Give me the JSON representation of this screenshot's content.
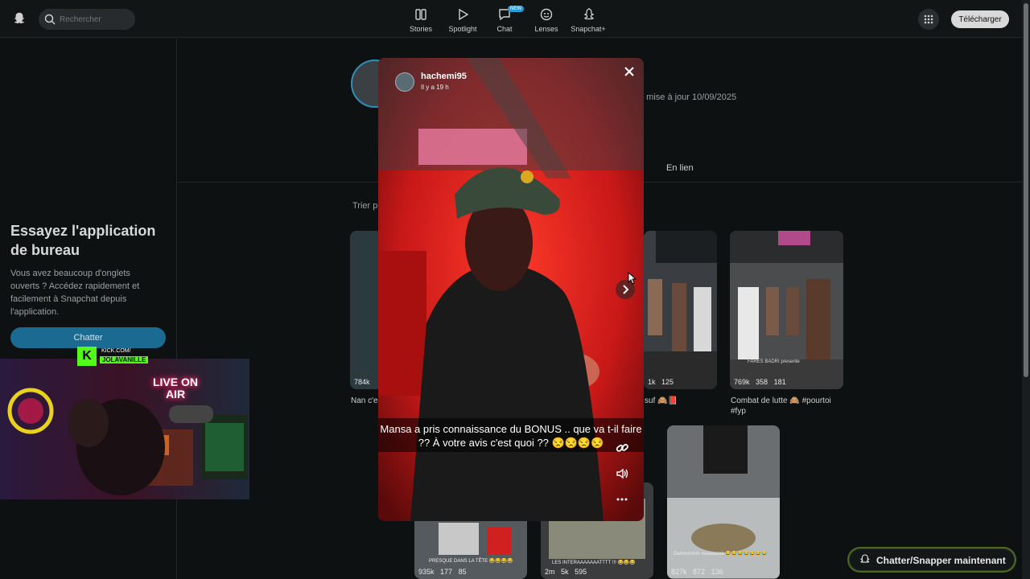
{
  "nav": {
    "search_placeholder": "Rechercher",
    "items": [
      {
        "label": "Stories",
        "icon": "stories-icon"
      },
      {
        "label": "Spotlight",
        "icon": "spotlight-play-icon"
      },
      {
        "label": "Chat",
        "icon": "chat-bubble-icon",
        "badge": "NEW"
      },
      {
        "label": "Lenses",
        "icon": "lenses-icon"
      },
      {
        "label": "Snapchat+",
        "icon": "snapchat-plus-icon"
      }
    ],
    "download_label": "Télécharger"
  },
  "profile": {
    "update_text": "e mise à jour 10/09/2025",
    "tab_label": "En lien",
    "sort_label": "Trier p"
  },
  "sidebar": {
    "promo_title": "Essayez l'application de bureau",
    "promo_text": "Vous avez beaucoup d'onglets ouverts ? Accédez rapidement et facilement à Snapchat depuis l'application.",
    "chat_button": "Chatter"
  },
  "overlay": {
    "kick_line1": "KICK.COM/",
    "kick_line2": "JOLAVANILLE",
    "neon_text": "LIVE ON AIR"
  },
  "story": {
    "username": "hachemi95",
    "time": "Il y a 19 h",
    "caption": "Mansa a pris connaissance du BONUS .. que va t-il faire ?? À votre avis c'est quoi ?? 😒😒😒😒"
  },
  "cards": {
    "c1": {
      "views": "784k",
      "caption": "Nan c'es"
    },
    "c2": {
      "stat1": "1k",
      "stat2": "125",
      "caption": "suf 🙈📕"
    },
    "c3": {
      "views": "769k",
      "shares": "358",
      "comments": "181",
      "caption": "Combat de lutte 🙈 #pourtoi #fyp"
    },
    "c4": {
      "views": "935k",
      "shares": "177",
      "comments": "85",
      "overlay_text": "PRESQUE DANS LA TÊTE 😂😂😂😂"
    },
    "c5": {
      "views": "2m",
      "shares": "5k",
      "comments": "595",
      "overlay_text": "LES INTERAAAAAAATTTT !!! 😂😂😂"
    },
    "c6": {
      "views": "827k",
      "shares": "872",
      "comments": "136",
      "overlay_text": "Dammmmm maaaaaaa 😂😂😂😂😂😂😂"
    },
    "poster_overlay": "FARES BADRI presente"
  },
  "footer": {
    "chat_now_label": "Chatter/Snapper maintenant"
  },
  "colors": {
    "accent_blue": "#1a6a92",
    "kick_green": "#53fc18",
    "modal_red": "#c22020"
  }
}
